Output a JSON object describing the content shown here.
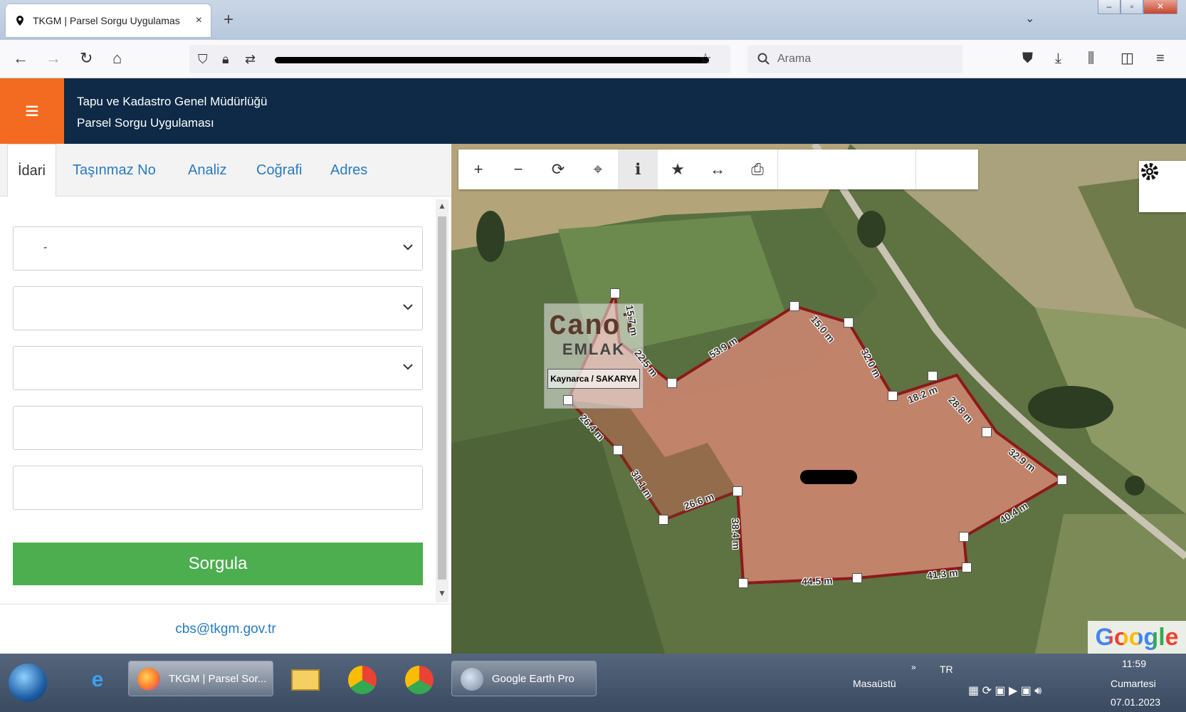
{
  "browser": {
    "tab_title": "TKGM | Parsel Sorgu Uygulamas",
    "tab_close": "×",
    "new_tab": "+",
    "search_placeholder": "Arama"
  },
  "header": {
    "org_line1": "Tapu ve Kadastro Genel Müdürlüğü",
    "org_line2": "Parsel Sorgu Uygulaması"
  },
  "panel": {
    "tabs": [
      "İdari",
      "Taşınmaz No",
      "Analiz",
      "Coğrafi",
      "Adres"
    ],
    "active_tab": "İdari",
    "fields": [
      {
        "value": "-",
        "type": "select"
      },
      {
        "value": "",
        "type": "select"
      },
      {
        "value": "",
        "type": "select"
      },
      {
        "value": "",
        "type": "input"
      },
      {
        "value": "",
        "type": "input"
      }
    ],
    "submit_label": "Sorgula",
    "contact_email": "cbs@tkgm.gov.tr"
  },
  "map": {
    "tools": [
      "zoom-in",
      "zoom-out",
      "refresh",
      "locate",
      "info",
      "favorite",
      "measure",
      "print"
    ],
    "google_label": "Google",
    "watermark": {
      "line1": "Canol",
      "line2": "EMLAK",
      "line3": "Kaynarca / SAKARYA"
    },
    "measurements": [
      "15.7 m",
      "22.5 m",
      "53.9 m",
      "15.0 m",
      "32.0 m",
      "18.2 m",
      "28.8 m",
      "32.9 m",
      "40.4 m",
      "41.3 m",
      "44.5 m",
      "38.4 m",
      "26.6 m",
      "31.1 m",
      "26.4 m"
    ],
    "colors": {
      "parcel_fill": "#e8897a",
      "parcel_stroke": "#8b1a1a"
    }
  },
  "taskbar": {
    "tasks": [
      {
        "label": "TKGM | Parsel Sor...",
        "icon": "firefox-icon"
      },
      {
        "label": "Google Earth Pro",
        "icon": "google-earth-icon"
      }
    ],
    "desktop_label": "Masaüstü",
    "language": "TR",
    "time": "11:59",
    "day": "Cumartesi",
    "date": "07.01.2023"
  }
}
